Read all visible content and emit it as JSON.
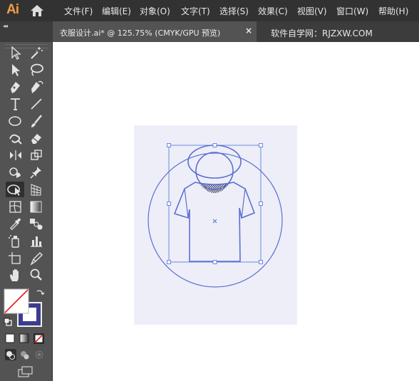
{
  "app": {
    "logo_text": "Ai"
  },
  "menu": {
    "items": [
      {
        "label": "文件(F)"
      },
      {
        "label": "编辑(E)"
      },
      {
        "label": "对象(O)"
      },
      {
        "label": "文字(T)"
      },
      {
        "label": "选择(S)"
      },
      {
        "label": "效果(C)"
      },
      {
        "label": "视图(V)"
      },
      {
        "label": "窗口(W)"
      },
      {
        "label": "帮助(H)"
      }
    ]
  },
  "tabs": {
    "collapse_glyph": "◂◂",
    "document_tab": {
      "label": "衣服设计.ai* @ 125.75% (CMYK/GPU 预览)",
      "close_glyph": "×"
    },
    "watermark": "软件自学网：RJZXW.COM"
  },
  "tools": [
    "selection-tool-icon",
    "magic-wand-tool-icon",
    "direct-selection-tool-icon",
    "lasso-tool-icon",
    "pen-tool-icon",
    "curvature-tool-icon",
    "type-tool-icon",
    "line-segment-tool-icon",
    "ellipse-tool-icon",
    "paintbrush-tool-icon",
    "shaper-tool-icon",
    "eraser-tool-icon",
    "width-tool-icon",
    "free-transform-tool-icon",
    "shape-builder-tool-icon",
    "pin-tool-icon",
    "live-paint-selection-tool-icon",
    "perspective-grid-tool-icon",
    "mesh-tool-icon",
    "gradient-tool-icon",
    "eyedropper-tool-icon",
    "blend-tool-icon",
    "symbol-sprayer-tool-icon",
    "column-graph-tool-icon",
    "artboard-tool-icon",
    "slice-tool-icon",
    "hand-tool-icon",
    "zoom-tool-icon"
  ],
  "colors": {
    "accent_stroke": "#5a6fd0",
    "bounding_box": "#4a70d8",
    "artboard_fill": "#eeeef9",
    "stroke_swatch": "#3c3c8e",
    "logo": "#f29a47"
  }
}
